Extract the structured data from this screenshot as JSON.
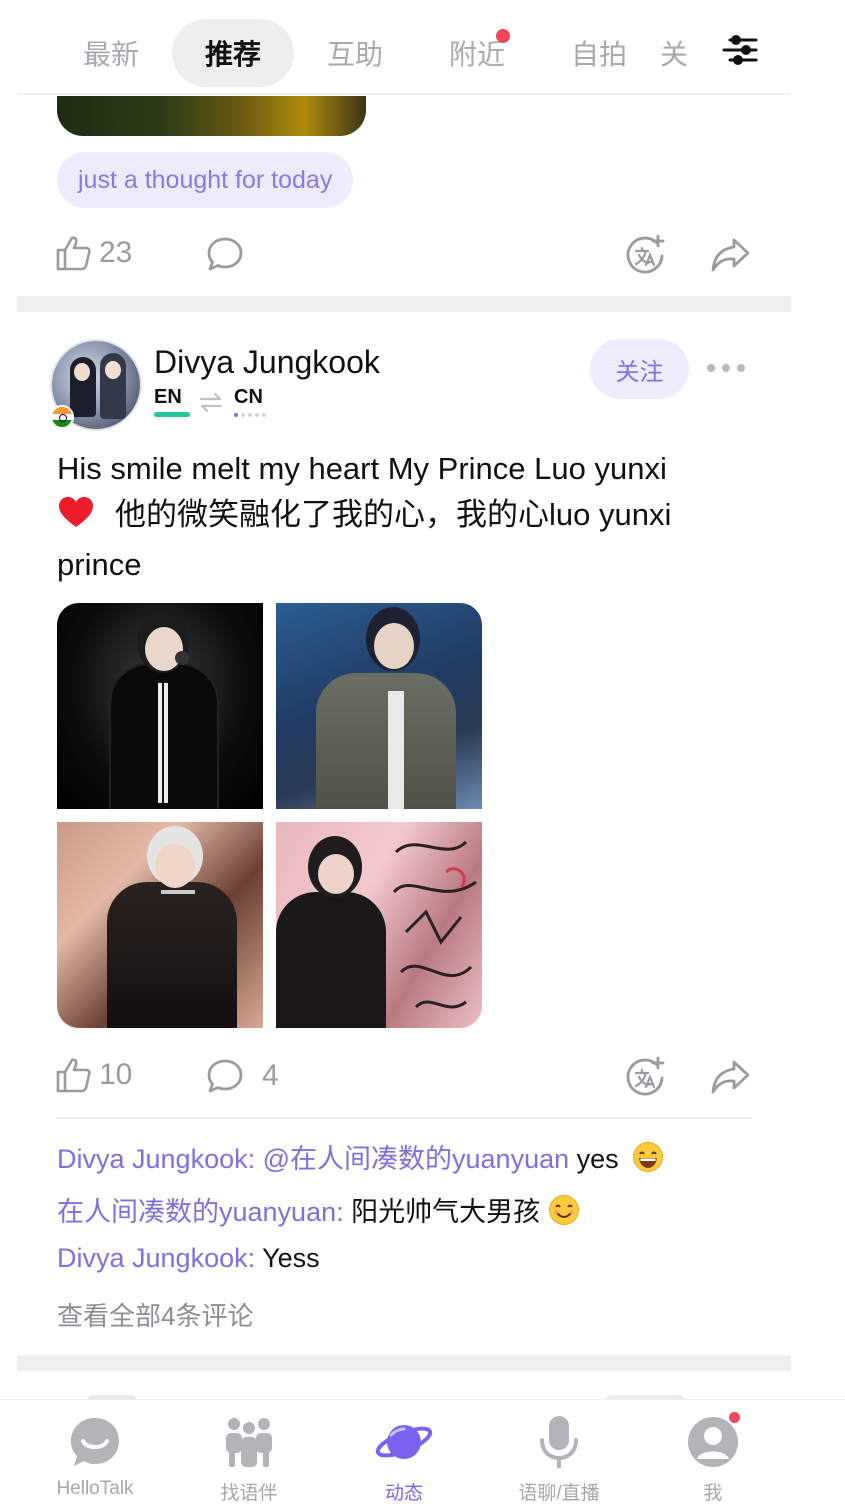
{
  "tabs": [
    {
      "label": "最新"
    },
    {
      "label": "推荐"
    },
    {
      "label": "互助"
    },
    {
      "label": "附近"
    },
    {
      "label": "自拍"
    },
    {
      "label": "关"
    }
  ],
  "first_post": {
    "tag": "just a thought for today",
    "likes": "23"
  },
  "post": {
    "username": "Divya Jungkook",
    "native_lang": "EN",
    "learning_lang": "CN",
    "follow_label": "关注",
    "text": "His smile melt my heart My Prince Luo yunxi",
    "text_line2": "他的微笑融化了我的心，我的心luo yunxi prince",
    "likes": "10",
    "comments": "4",
    "comment_list": [
      {
        "author": "Divya Jungkook: ",
        "mention": "@在人间凑数的yuanyuan",
        "text": " yes"
      },
      {
        "author": "在人间凑数的yuanyuan: ",
        "text": "阳光帅气大男孩"
      },
      {
        "author": "Divya Jungkook: ",
        "text": "Yess"
      }
    ],
    "view_all": "查看全部4条评论"
  },
  "bottom_nav": [
    {
      "label": "HelloTalk",
      "icon": "hellotalk-chat-icon"
    },
    {
      "label": "找语伴",
      "icon": "partners-icon"
    },
    {
      "label": "动态",
      "icon": "planet-icon"
    },
    {
      "label": "语聊/直播",
      "icon": "microphone-icon"
    },
    {
      "label": "我",
      "icon": "profile-icon"
    }
  ],
  "colors": {
    "accent": "#7b63f0",
    "chip_bg": "#eeebfd",
    "badge": "#f0475c",
    "native_bar": "#1fc99a"
  }
}
